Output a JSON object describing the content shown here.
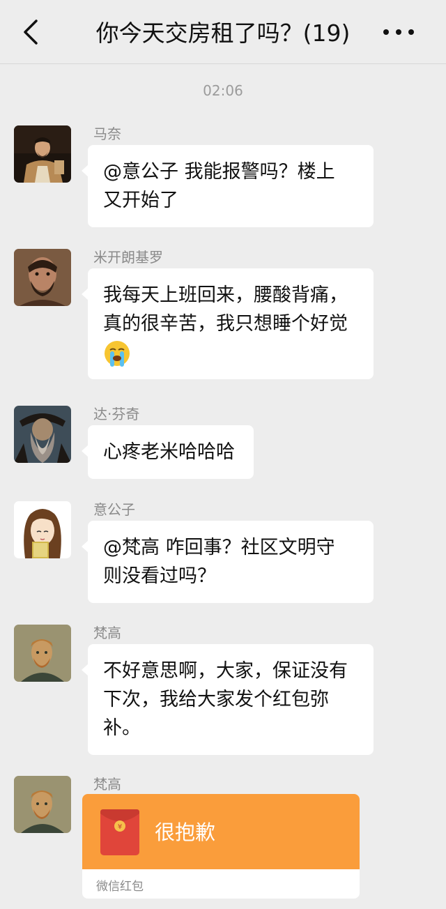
{
  "header": {
    "title": "你今天交房租了吗？(19)",
    "back_icon": "chevron-left-icon",
    "more_icon": "more-dots-icon"
  },
  "timestamp": "02:06",
  "messages": [
    {
      "sender": "马奈",
      "text_lines": [
        "@意公子 我能报警吗？楼上",
        "又开始了"
      ]
    },
    {
      "sender": "米开朗基罗",
      "text_lines": [
        "我每天上班回来，腰酸背痛，",
        "真的很辛苦，我只想睡个好觉"
      ],
      "emoji": "crying-face-icon"
    },
    {
      "sender": "达·芬奇",
      "text_lines": [
        "心疼老米哈哈哈"
      ]
    },
    {
      "sender": "意公子",
      "text_lines": [
        "@梵高 咋回事？社区文明守",
        "则没看过吗？"
      ]
    },
    {
      "sender": "梵高",
      "text_lines": [
        "不好意思啊，大家，保证没有",
        "下次，我给大家发个红包弥",
        "补。"
      ]
    },
    {
      "sender": "梵高",
      "red_packet": {
        "greeting": "很抱歉",
        "footer": "微信红包",
        "icon": "red-envelope-icon"
      }
    }
  ],
  "colors": {
    "background": "#ededed",
    "bubble": "#ffffff",
    "red_packet": "#fa9d3b",
    "envelope": "#e0453a"
  }
}
